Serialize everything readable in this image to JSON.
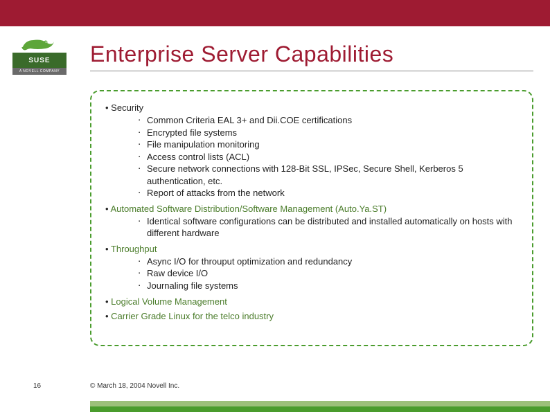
{
  "logo": {
    "brand": "SUSE",
    "subline": "A NOVELL COMPANY"
  },
  "title": "Enterprise Server Capabilities",
  "sections": [
    {
      "label": "Security",
      "colored": false,
      "subs": [
        "Common Criteria EAL 3+ and Dii.COE certifications",
        "Encrypted file systems",
        "File manipulation monitoring",
        "Access control lists (ACL)",
        "Secure network connections with 128-Bit SSL, IPSec, Secure Shell, Kerberos 5 authentication, etc.",
        "Report of attacks from the network"
      ]
    },
    {
      "label": "Automated Software Distribution/Software Management (Auto.Ya.ST)",
      "colored": true,
      "subs": [
        "Identical software configurations can be distributed and installed automatically on hosts with different hardware"
      ]
    },
    {
      "label": "Throughput",
      "colored": true,
      "subs": [
        "Async I/O for throuput optimization and redundancy",
        "Raw device I/O",
        "Journaling file systems"
      ]
    },
    {
      "label": "Logical Volume Management",
      "colored": true,
      "subs": []
    },
    {
      "label": "Carrier Grade Linux for the telco industry",
      "colored": true,
      "subs": []
    }
  ],
  "footer": {
    "page": "16",
    "copyright": "© March 18, 2004 Novell Inc."
  }
}
